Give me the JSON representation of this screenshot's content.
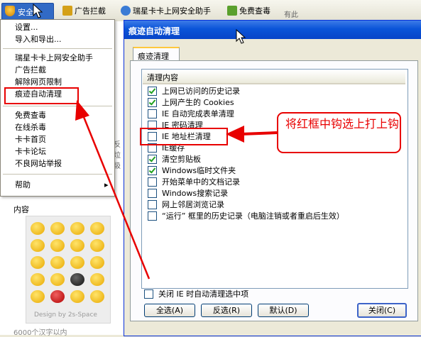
{
  "toolbar": {
    "menu_button": "安全",
    "items": [
      {
        "label": "广告拦截",
        "icon": "shield-ad-icon"
      },
      {
        "label": "瑞星卡卡上网安全助手",
        "icon": "kaka-icon"
      },
      {
        "label": "免费查毒",
        "icon": "scan-icon"
      }
    ]
  },
  "menu": {
    "items": [
      "设置...",
      "导入和导出...",
      "瑞星卡卡上网安全助手",
      "广告拦截",
      "解除网页限制",
      "痕迹自动清理",
      "免费查毒",
      "在线杀毒",
      "卡卡首页",
      "卡卡论坛",
      "不良网站举报",
      "帮助"
    ],
    "submenu_arrow": "▸"
  },
  "left_page": {
    "content_label": "内容",
    "emoji_caption": "Design by 2s-Space",
    "bottom_text": "6000个汉字以内",
    "bg_snippets": [
      "反垃圾",
      "有此"
    ]
  },
  "dialog": {
    "title": "痕迹自动清理",
    "tab": "痕迹清理",
    "list_header": "清理内容",
    "items": [
      {
        "label": "上网已访问的历史记录",
        "checked": true
      },
      {
        "label": "上网产生的 Cookies",
        "checked": true
      },
      {
        "label": "IE 自动完成表单清理",
        "checked": false
      },
      {
        "label": "IE 密码清理",
        "checked": false
      },
      {
        "label": "IE 地址栏清理",
        "checked": false
      },
      {
        "label": "IE缓存",
        "checked": false
      },
      {
        "label": "清空剪贴板",
        "checked": true
      },
      {
        "label": "Windows临时文件夹",
        "checked": true
      },
      {
        "label": "开始菜单中的文档记录",
        "checked": false
      },
      {
        "label": "Windows搜索记录",
        "checked": false
      },
      {
        "label": "网上邻居浏览记录",
        "checked": false
      },
      {
        "label": "“运行” 框里的历史记录（电脑注销或者重启后生效）",
        "checked": false
      }
    ],
    "close_ie_option": {
      "label": "关闭 IE 时自动清理选中项",
      "checked": false
    },
    "buttons": {
      "select_all": "全选(A)",
      "invert": "反选(R)",
      "default": "默认(D)",
      "close": "关闭(C)"
    }
  },
  "annotation": {
    "text": "将红框中钩选上打上钩",
    "color": "#E80000"
  }
}
